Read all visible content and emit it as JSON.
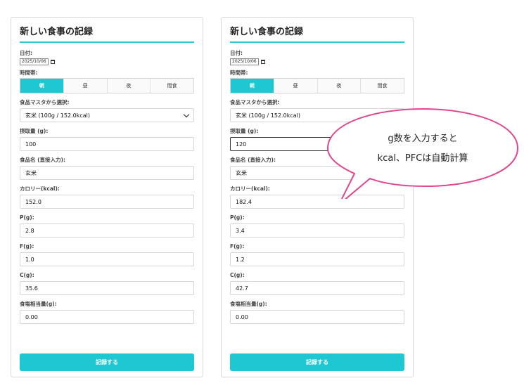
{
  "form_title": "新しい食事の記録",
  "labels": {
    "date": "日付:",
    "time_slot": "時間帯:",
    "food_master": "食品マスタから選択:",
    "amount": "摂取量 (g):",
    "food_name": "食品名 (直接入力):",
    "calorie": "カロリー(kcal):",
    "p": "P(g):",
    "f": "F(g):",
    "c": "C(g):",
    "salt": "食塩相当量(g):"
  },
  "date_value": "2025/10/06",
  "time_slots": [
    "朝",
    "昼",
    "夜",
    "間食"
  ],
  "selected_slot": "朝",
  "submit_label": "記録する",
  "left": {
    "food_select": "玄米 (100g / 152.0kcal)",
    "amount": "100",
    "food_name": "玄米",
    "calorie": "152.0",
    "p": "2.8",
    "f": "1.0",
    "c": "35.6",
    "salt": "0.00"
  },
  "right": {
    "food_select": "玄米 (100g / 152.0kcal)",
    "amount": "120",
    "food_name": "玄米",
    "calorie": "182.4",
    "p": "3.4",
    "f": "1.2",
    "c": "42.7",
    "salt": "0.00"
  },
  "callout": {
    "line1": "g数を入力すると",
    "line2": "kcal、PFCは自動計算"
  },
  "colors": {
    "accent": "#1ec8d2",
    "bubble_border": "#e0458f"
  }
}
